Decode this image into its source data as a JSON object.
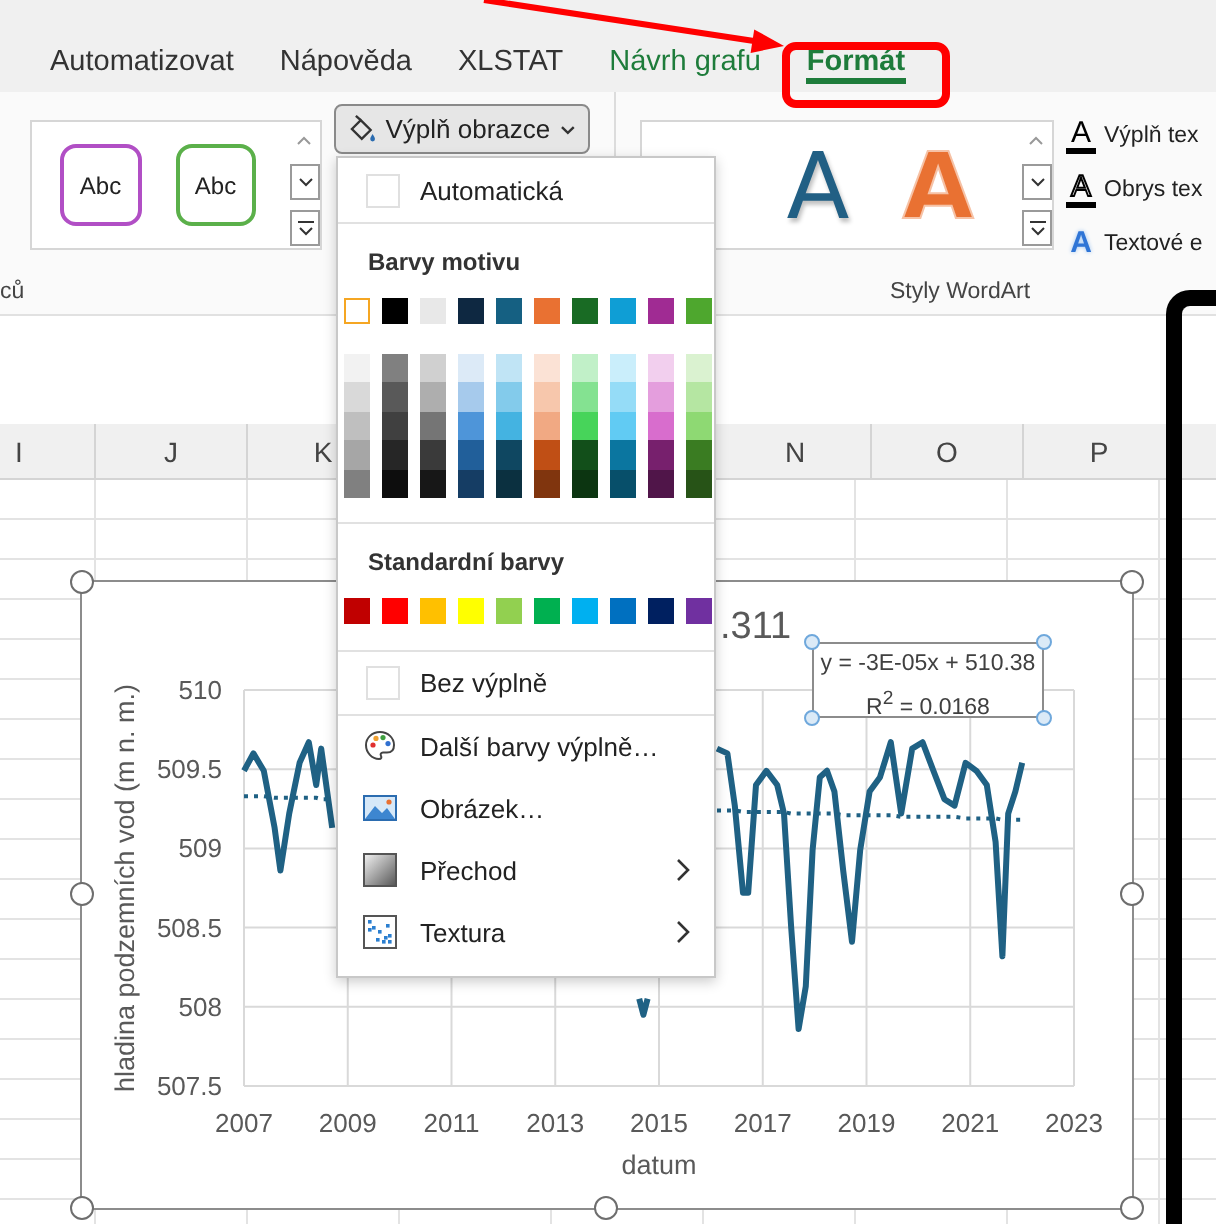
{
  "tabs": [
    {
      "label": "Automatizovat",
      "contextual": false,
      "selected": false,
      "highlighted": false
    },
    {
      "label": "Nápověda",
      "contextual": false,
      "selected": false,
      "highlighted": false
    },
    {
      "label": "XLSTAT",
      "contextual": false,
      "selected": false,
      "highlighted": false
    },
    {
      "label": "Návrh grafu",
      "contextual": true,
      "selected": false,
      "highlighted": false
    },
    {
      "label": "Formát",
      "contextual": true,
      "selected": true,
      "highlighted": true
    }
  ],
  "ribbon": {
    "shape_styles": {
      "items": [
        {
          "label": "Abc",
          "color": "#b14fc5"
        },
        {
          "label": "Abc",
          "color": "#5bb04a"
        }
      ],
      "group_label": "ců"
    },
    "shape_fill_button": {
      "label": "Výplň obrazce",
      "expanded": true
    },
    "wordart_styles": {
      "items": [
        {
          "label": "A",
          "kind": "filled",
          "color": "#215f84"
        },
        {
          "label": "A",
          "kind": "outline",
          "color": "#e97132"
        }
      ],
      "group_label": "Styly WordArt"
    },
    "text_commands": [
      {
        "kind": "fill",
        "icon_letter": "A",
        "label": "Výplň tex"
      },
      {
        "kind": "outline",
        "icon_letter": "A",
        "label": "Obrys tex"
      },
      {
        "kind": "effects",
        "icon_letter": "A",
        "label": "Textové e"
      }
    ]
  },
  "sheet": {
    "columns_left": [
      "I",
      "J",
      "K"
    ],
    "columns_right": [
      "N",
      "O",
      "P"
    ]
  },
  "fill_menu": {
    "items": [
      {
        "kind": "swatch_option",
        "label": "Automatická"
      },
      {
        "kind": "heading",
        "label": "Barvy motivu"
      },
      {
        "kind": "theme_palette",
        "colors": [
          {
            "color": "#ffffff",
            "selected": true,
            "tints": [
              {
                "color": "#f2f2f2"
              },
              {
                "color": "#d9d9d9"
              },
              {
                "color": "#bfbfbf"
              },
              {
                "color": "#a6a6a6"
              },
              {
                "color": "#808080"
              }
            ]
          },
          {
            "color": "#000000",
            "selected": false,
            "tints": [
              {
                "color": "#808080"
              },
              {
                "color": "#595959"
              },
              {
                "color": "#404040"
              },
              {
                "color": "#262626"
              },
              {
                "color": "#0d0d0d"
              }
            ]
          },
          {
            "color": "#e8e8e8",
            "selected": false,
            "tints": [
              {
                "color": "#d0d0d0"
              },
              {
                "color": "#aeaeae"
              },
              {
                "color": "#757575"
              },
              {
                "color": "#3a3a3a"
              },
              {
                "color": "#171717"
              }
            ]
          },
          {
            "color": "#0e2841",
            "selected": false,
            "tints": [
              {
                "color": "#dceaf7"
              },
              {
                "color": "#a6caec"
              },
              {
                "color": "#4e95d9"
              },
              {
                "color": "#215f9a"
              },
              {
                "color": "#153d64"
              }
            ]
          },
          {
            "color": "#156082",
            "selected": false,
            "tints": [
              {
                "color": "#c0e4f5"
              },
              {
                "color": "#83cbeb"
              },
              {
                "color": "#44b3e1"
              },
              {
                "color": "#0f4761"
              },
              {
                "color": "#0b3040"
              }
            ]
          },
          {
            "color": "#e97132",
            "selected": false,
            "tints": [
              {
                "color": "#fbe2d5"
              },
              {
                "color": "#f7c7ac"
              },
              {
                "color": "#f1a983"
              },
              {
                "color": "#c04f15"
              },
              {
                "color": "#80350e"
              }
            ]
          },
          {
            "color": "#196b24",
            "selected": false,
            "tints": [
              {
                "color": "#c1f0c8"
              },
              {
                "color": "#84e291"
              },
              {
                "color": "#47d45a"
              },
              {
                "color": "#124f1a"
              },
              {
                "color": "#0c3511"
              }
            ]
          },
          {
            "color": "#0f9ed5",
            "selected": false,
            "tints": [
              {
                "color": "#caeefb"
              },
              {
                "color": "#95dcf7"
              },
              {
                "color": "#61cbf3"
              },
              {
                "color": "#0b76a0"
              },
              {
                "color": "#074f6a"
              }
            ]
          },
          {
            "color": "#a02b93",
            "selected": false,
            "tints": [
              {
                "color": "#f2cfee"
              },
              {
                "color": "#e49edd"
              },
              {
                "color": "#d86dcd"
              },
              {
                "color": "#77206d"
              },
              {
                "color": "#501549"
              }
            ]
          },
          {
            "color": "#4ea72e",
            "selected": false,
            "tints": [
              {
                "color": "#daf2d0"
              },
              {
                "color": "#b5e6a2"
              },
              {
                "color": "#8ed973"
              },
              {
                "color": "#3a7c22"
              },
              {
                "color": "#275317"
              }
            ]
          }
        ]
      },
      {
        "kind": "heading",
        "label": "Standardní barvy"
      },
      {
        "kind": "standard_palette",
        "colors": [
          {
            "color": "#c00000",
            "selected": false
          },
          {
            "color": "#ff0000",
            "selected": false
          },
          {
            "color": "#ffc000",
            "selected": false
          },
          {
            "color": "#ffff00",
            "selected": false
          },
          {
            "color": "#92d050",
            "selected": false
          },
          {
            "color": "#00b050",
            "selected": false
          },
          {
            "color": "#00b0f0",
            "selected": false
          },
          {
            "color": "#0070c0",
            "selected": false
          },
          {
            "color": "#002060",
            "selected": false
          },
          {
            "color": "#7030a0",
            "selected": false
          }
        ]
      },
      {
        "kind": "swatch_option",
        "label": "Bez výplně"
      },
      {
        "kind": "more_colors",
        "label": "Další barvy výplně…",
        "submenu": false
      },
      {
        "kind": "picture_fill",
        "label": "Obrázek…",
        "submenu": false
      },
      {
        "kind": "gradient_fill",
        "label": "Přechod",
        "submenu": true
      },
      {
        "kind": "texture_fill",
        "label": "Textura",
        "submenu": true
      }
    ]
  },
  "chart": {
    "selected": true,
    "trendline_label": {
      "selected": true,
      "lines": [
        "y = -3E-05x + 510.38",
        "R$^{2}$ = 0.0168"
      ]
    },
    "chart_data": {
      "type": "line",
      "title": ".311",
      "xlabel": "datum",
      "ylabel": "hladina podzemních vod (m n. m.)",
      "grid": true,
      "x": [
        2007,
        2007.18,
        2007.38,
        2007.59,
        2007.7,
        2007.87,
        2008.07,
        2008.25,
        2008.39,
        2008.49,
        2008.7,
        2008.85,
        2014.62,
        2014.7,
        2014.78,
        2014.9,
        2016.12,
        2016.32,
        2016.46,
        2016.62,
        2016.72,
        2016.87,
        2017.07,
        2017.28,
        2017.41,
        2017.55,
        2017.69,
        2017.83,
        2017.96,
        2018.1,
        2018.24,
        2018.38,
        2018.55,
        2018.72,
        2018.88,
        2019.06,
        2019.26,
        2019.47,
        2019.67,
        2019.88,
        2020.08,
        2020.29,
        2020.5,
        2020.7,
        2020.91,
        2021.12,
        2021.32,
        2021.49,
        2021.62,
        2021.73,
        2021.87,
        2022
      ],
      "series": [
        {
          "color": "#1f6184",
          "line_style": "solid",
          "values": [
            509.49,
            509.6,
            509.49,
            509.13,
            508.86,
            509.22,
            509.54,
            509.67,
            509.4,
            509.63,
            509.13,
            null,
            508.05,
            507.95,
            508.05,
            null,
            509.63,
            509.6,
            509.27,
            508.72,
            508.72,
            509.4,
            509.49,
            509.4,
            509.22,
            508.5,
            507.86,
            508.13,
            508.99,
            509.45,
            509.49,
            509.36,
            508.86,
            508.41,
            508.99,
            509.36,
            509.45,
            509.67,
            509.22,
            509.63,
            509.67,
            509.49,
            509.31,
            509.27,
            509.54,
            509.49,
            509.4,
            509.04,
            508.32,
            509.22,
            509.36,
            509.54
          ]
        },
        {
          "color": "#1f6184",
          "line_style": "dotted",
          "values": [
            509.33,
            509.33,
            509.33,
            509.32,
            509.32,
            509.32,
            509.32,
            509.32,
            509.32,
            509.31,
            509.31,
            null,
            null,
            null,
            null,
            null,
            509.24,
            509.24,
            509.24,
            509.23,
            509.23,
            509.23,
            509.23,
            509.23,
            509.23,
            509.22,
            509.22,
            509.22,
            509.22,
            509.22,
            509.22,
            509.22,
            509.21,
            509.21,
            509.21,
            509.21,
            509.21,
            509.21,
            509.2,
            509.2,
            509.2,
            509.2,
            509.2,
            509.2,
            509.19,
            509.19,
            509.19,
            509.19,
            509.18,
            509.18,
            509.18,
            509.18
          ]
        }
      ],
      "xlim": [
        2007,
        2023
      ],
      "ylim": [
        507.5,
        510
      ],
      "xticks": [
        2007,
        2009,
        2011,
        2013,
        2015,
        2017,
        2019,
        2021,
        2023
      ],
      "yticks": [
        507.5,
        508,
        508.5,
        509,
        509.5,
        510
      ]
    }
  }
}
